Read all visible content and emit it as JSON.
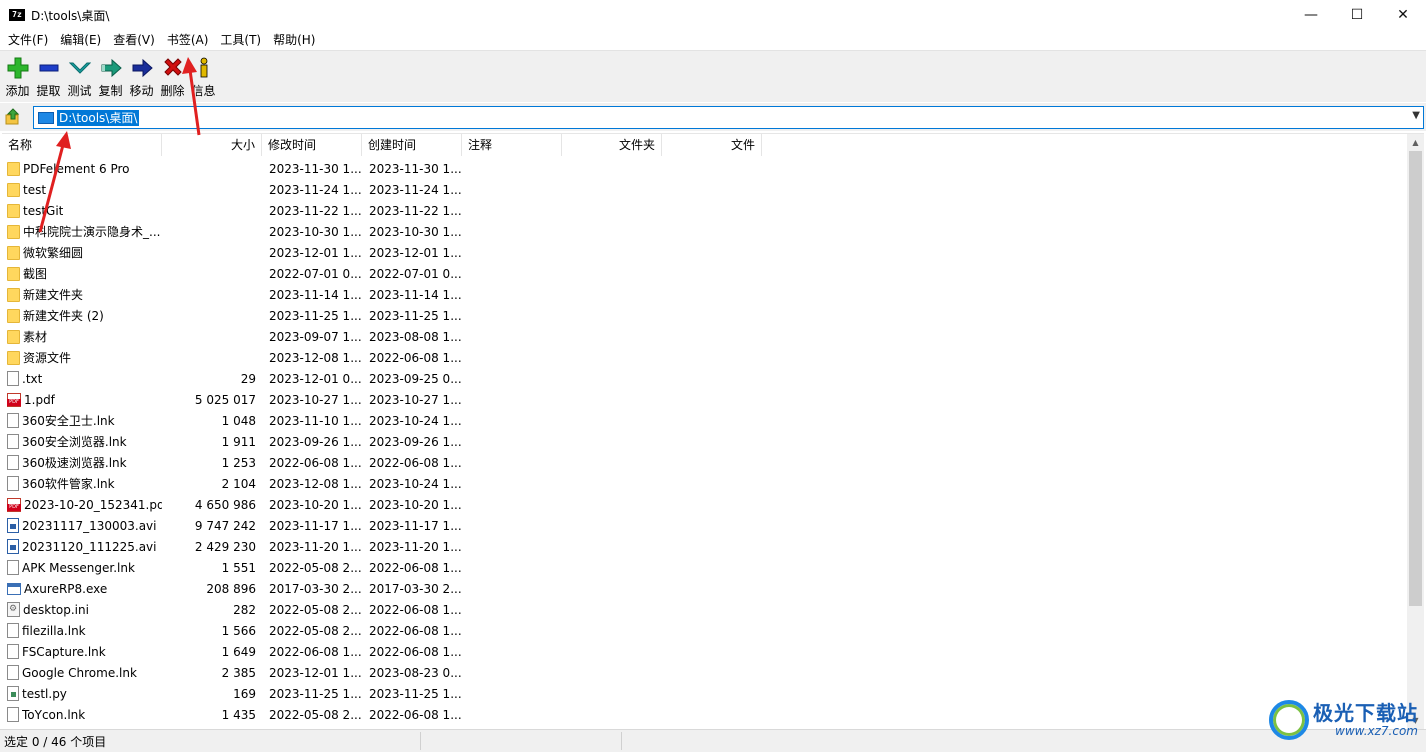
{
  "window": {
    "title": "D:\\tools\\桌面\\",
    "app_icon_text": "7z",
    "controls": {
      "minimize": "—",
      "maximize": "☐",
      "close": "✕"
    }
  },
  "menu": [
    {
      "label": "文件(F)"
    },
    {
      "label": "编辑(E)"
    },
    {
      "label": "查看(V)"
    },
    {
      "label": "书签(A)"
    },
    {
      "label": "工具(T)"
    },
    {
      "label": "帮助(H)"
    }
  ],
  "toolbar": [
    {
      "label": "添加",
      "icon": "add-icon",
      "color": "#2db62d"
    },
    {
      "label": "提取",
      "icon": "extract-icon",
      "color": "#1e3ec8"
    },
    {
      "label": "测试",
      "icon": "test-icon",
      "color": "#1aa3a3"
    },
    {
      "label": "复制",
      "icon": "copy-icon",
      "color": "#1a9a7a"
    },
    {
      "label": "移动",
      "icon": "move-icon",
      "color": "#1a2e9a"
    },
    {
      "label": "删除",
      "icon": "delete-icon",
      "color": "#d01010"
    },
    {
      "label": "信息",
      "icon": "info-icon",
      "color": "#e0b800"
    }
  ],
  "address": {
    "value": "D:\\tools\\桌面\\"
  },
  "columns": [
    "名称",
    "大小",
    "修改时间",
    "创建时间",
    "注释",
    "文件夹",
    "文件"
  ],
  "rows": [
    {
      "name": "PDFelement 6 Pro",
      "size": "",
      "modified": "2023-11-30 1...",
      "created": "2023-11-30 1...",
      "type": "folder"
    },
    {
      "name": "test",
      "size": "",
      "modified": "2023-11-24 1...",
      "created": "2023-11-24 1...",
      "type": "folder"
    },
    {
      "name": "testGit",
      "size": "",
      "modified": "2023-11-22 1...",
      "created": "2023-11-22 1...",
      "type": "folder"
    },
    {
      "name": "中科院院士演示隐身术_...",
      "size": "",
      "modified": "2023-10-30 1...",
      "created": "2023-10-30 1...",
      "type": "folder"
    },
    {
      "name": "微软繁细圆",
      "size": "",
      "modified": "2023-12-01 1...",
      "created": "2023-12-01 1...",
      "type": "folder"
    },
    {
      "name": "截图",
      "size": "",
      "modified": "2022-07-01 0...",
      "created": "2022-07-01 0...",
      "type": "folder"
    },
    {
      "name": "新建文件夹",
      "size": "",
      "modified": "2023-11-14 1...",
      "created": "2023-11-14 1...",
      "type": "folder"
    },
    {
      "name": "新建文件夹 (2)",
      "size": "",
      "modified": "2023-11-25 1...",
      "created": "2023-11-25 1...",
      "type": "folder"
    },
    {
      "name": "素材",
      "size": "",
      "modified": "2023-09-07 1...",
      "created": "2023-08-08 1...",
      "type": "folder"
    },
    {
      "name": "资源文件",
      "size": "",
      "modified": "2023-12-08 1...",
      "created": "2022-06-08 1...",
      "type": "folder"
    },
    {
      "name": ".txt",
      "size": "29",
      "modified": "2023-12-01 0...",
      "created": "2023-09-25 0...",
      "type": "file"
    },
    {
      "name": "1.pdf",
      "size": "5 025 017",
      "modified": "2023-10-27 1...",
      "created": "2023-10-27 1...",
      "type": "pdf"
    },
    {
      "name": "360安全卫士.lnk",
      "size": "1 048",
      "modified": "2023-11-10 1...",
      "created": "2023-10-24 1...",
      "type": "file"
    },
    {
      "name": "360安全浏览器.lnk",
      "size": "1 911",
      "modified": "2023-09-26 1...",
      "created": "2023-09-26 1...",
      "type": "file"
    },
    {
      "name": "360极速浏览器.lnk",
      "size": "1 253",
      "modified": "2022-06-08 1...",
      "created": "2022-06-08 1...",
      "type": "file"
    },
    {
      "name": "360软件管家.lnk",
      "size": "2 104",
      "modified": "2023-12-08 1...",
      "created": "2023-10-24 1...",
      "type": "file"
    },
    {
      "name": "2023-10-20_152341.pdf",
      "size": "4 650 986",
      "modified": "2023-10-20 1...",
      "created": "2023-10-20 1...",
      "type": "pdf"
    },
    {
      "name": "20231117_130003.avi",
      "size": "9 747 242",
      "modified": "2023-11-17 1...",
      "created": "2023-11-17 1...",
      "type": "video"
    },
    {
      "name": "20231120_111225.avi",
      "size": "2 429 230",
      "modified": "2023-11-20 1...",
      "created": "2023-11-20 1...",
      "type": "video"
    },
    {
      "name": "APK Messenger.lnk",
      "size": "1 551",
      "modified": "2022-05-08 2...",
      "created": "2022-06-08 1...",
      "type": "file"
    },
    {
      "name": "AxureRP8.exe",
      "size": "208 896",
      "modified": "2017-03-30 2...",
      "created": "2017-03-30 2...",
      "type": "exe"
    },
    {
      "name": "desktop.ini",
      "size": "282",
      "modified": "2022-05-08 2...",
      "created": "2022-06-08 1...",
      "type": "ini"
    },
    {
      "name": "filezilla.lnk",
      "size": "1 566",
      "modified": "2022-05-08 2...",
      "created": "2022-06-08 1...",
      "type": "file"
    },
    {
      "name": "FSCapture.lnk",
      "size": "1 649",
      "modified": "2022-06-08 1...",
      "created": "2022-06-08 1...",
      "type": "file"
    },
    {
      "name": "Google Chrome.lnk",
      "size": "2 385",
      "modified": "2023-12-01 1...",
      "created": "2023-08-23 0...",
      "type": "file"
    },
    {
      "name": "testl.py",
      "size": "169",
      "modified": "2023-11-25 1...",
      "created": "2023-11-25 1...",
      "type": "py"
    },
    {
      "name": "ToYcon.lnk",
      "size": "1 435",
      "modified": "2022-05-08 2...",
      "created": "2022-06-08 1...",
      "type": "file"
    }
  ],
  "status": {
    "text": "选定 0 / 46 个项目"
  },
  "watermark": {
    "name": "极光下载站",
    "url": "www.xz7.com"
  }
}
